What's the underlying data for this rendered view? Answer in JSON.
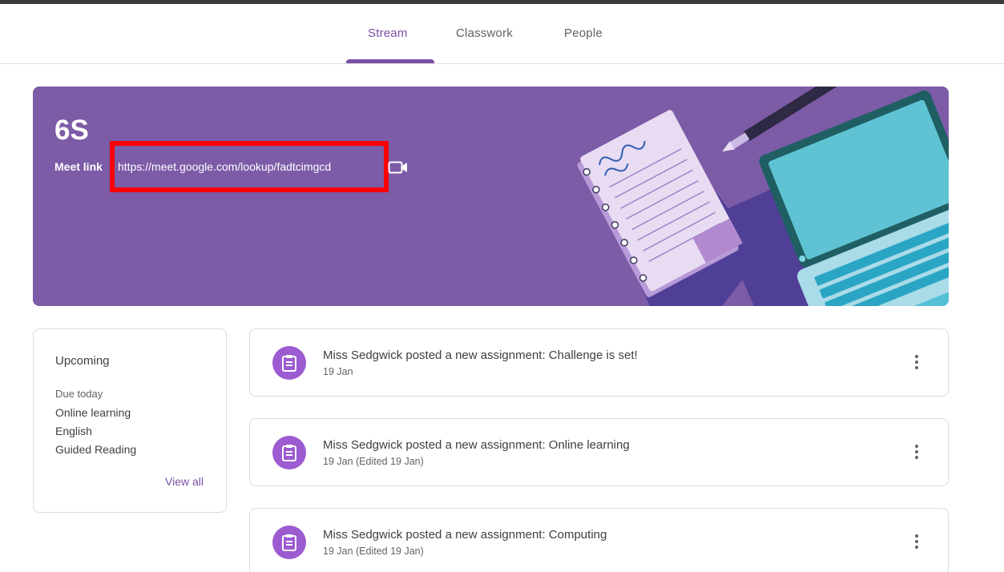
{
  "tabs": [
    {
      "label": "Stream",
      "active": true
    },
    {
      "label": "Classwork",
      "active": false
    },
    {
      "label": "People",
      "active": false
    }
  ],
  "banner": {
    "title": "6S",
    "meet_label": "Meet link",
    "meet_url": "https://meet.google.com/lookup/fadtcimgcd",
    "background_color": "#7c5ba7",
    "highlight_color": "#ff0000"
  },
  "upcoming": {
    "title": "Upcoming",
    "due_label": "Due today",
    "items": [
      "Online learning",
      "English",
      "Guided Reading"
    ],
    "view_all": "View all"
  },
  "posts": [
    {
      "title": "Miss Sedgwick posted a new assignment: Challenge is set!",
      "date": "19 Jan"
    },
    {
      "title": "Miss Sedgwick posted a new assignment: Online learning",
      "date": "19 Jan (Edited 19 Jan)"
    },
    {
      "title": "Miss Sedgwick posted a new assignment: Computing",
      "date": "19 Jan (Edited 19 Jan)"
    }
  ],
  "colors": {
    "accent": "#7b4fa6",
    "assignment_icon": "#9c5bd1"
  },
  "icons": {
    "video": "video-camera-icon",
    "assignment": "assignment-clipboard-icon",
    "more": "more-vertical-icon"
  }
}
